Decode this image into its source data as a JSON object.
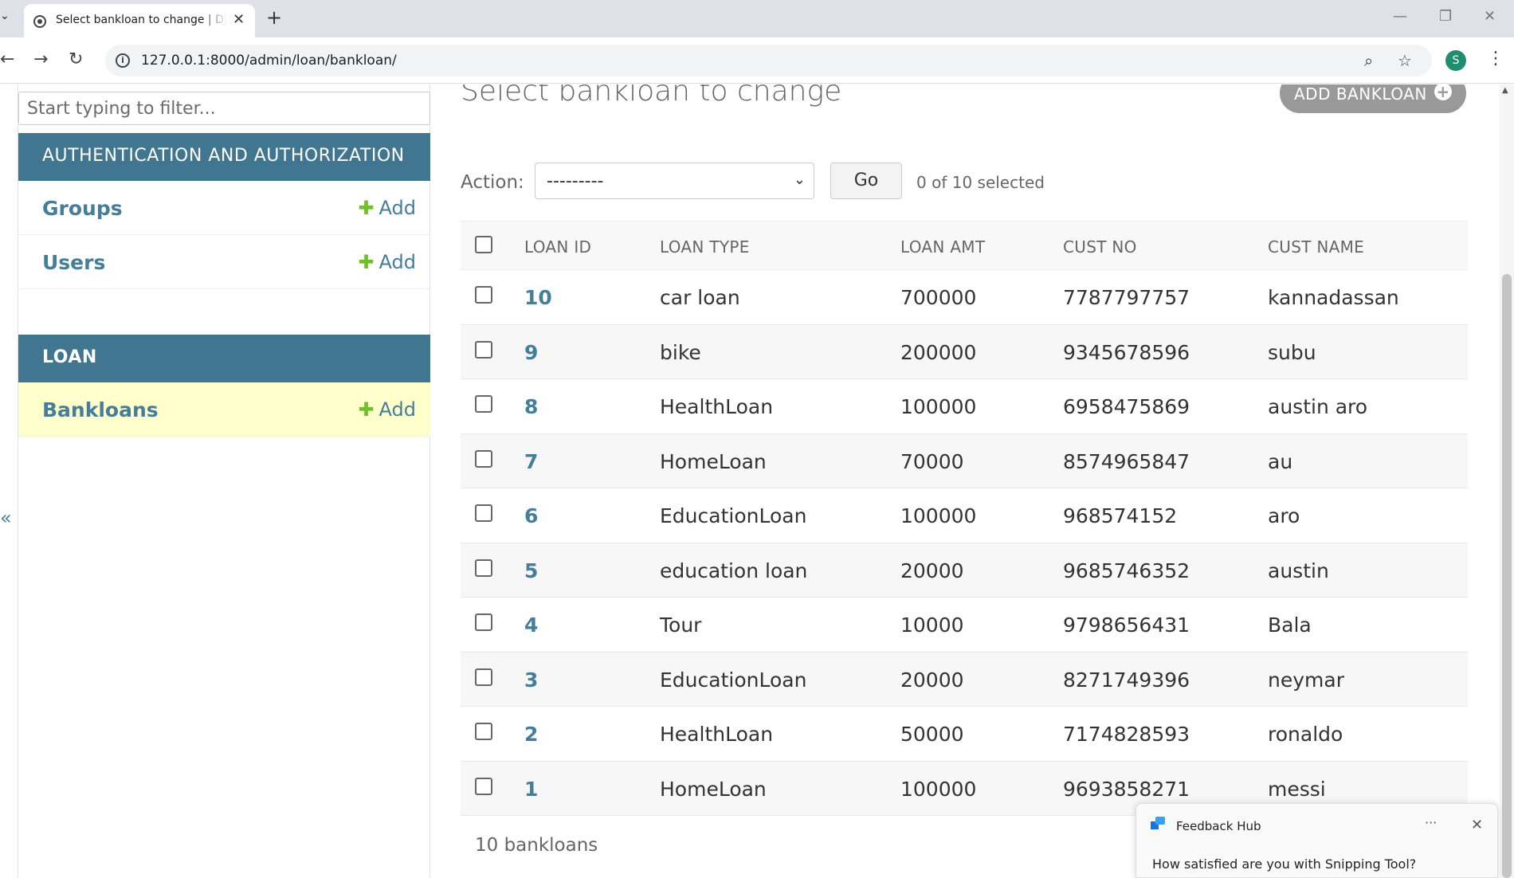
{
  "browser": {
    "tab_title": "Select bankloan to change | Django site admin",
    "url": "127.0.0.1:8000/admin/loan/bankloan/",
    "avatar_letter": "S"
  },
  "sidebar": {
    "filter_placeholder": "Start typing to filter...",
    "apps": [
      {
        "name": "AUTHENTICATION AND AUTHORIZATION",
        "models": [
          {
            "label": "Groups",
            "add": "Add"
          },
          {
            "label": "Users",
            "add": "Add"
          }
        ]
      },
      {
        "name": "LOAN",
        "models": [
          {
            "label": "Bankloans",
            "add": "Add"
          }
        ]
      }
    ],
    "collapse_glyph": "«"
  },
  "main": {
    "title": "Select bankloan to change",
    "add_button": "ADD BANKLOAN",
    "action_label": "Action:",
    "action_value": "---------",
    "go_label": "Go",
    "selected_text": "0 of 10 selected",
    "columns": [
      "LOAN ID",
      "LOAN TYPE",
      "LOAN AMT",
      "CUST NO",
      "CUST NAME"
    ],
    "rows": [
      [
        "10",
        "car loan",
        "700000",
        "7787797757",
        "kannadassan"
      ],
      [
        "9",
        "bike",
        "200000",
        "9345678596",
        "subu"
      ],
      [
        "8",
        "HealthLoan",
        "100000",
        "6958475869",
        "austin aro"
      ],
      [
        "7",
        "HomeLoan",
        "70000",
        "8574965847",
        "au"
      ],
      [
        "6",
        "EducationLoan",
        "100000",
        "968574152",
        "aro"
      ],
      [
        "5",
        "education loan",
        "20000",
        "9685746352",
        "austin"
      ],
      [
        "4",
        "Tour",
        "10000",
        "9798656431",
        "Bala"
      ],
      [
        "3",
        "EducationLoan",
        "20000",
        "8271749396",
        "neymar"
      ],
      [
        "2",
        "HealthLoan",
        "50000",
        "7174828593",
        "ronaldo"
      ],
      [
        "1",
        "HomeLoan",
        "100000",
        "9693858271",
        "messi"
      ]
    ],
    "paginator": "10 bankloans"
  },
  "toast": {
    "app": "Feedback Hub",
    "question": "How satisfied are you with Snipping Tool?",
    "more": "···",
    "close": "✕"
  },
  "colors": {
    "header_blue": "#417690",
    "link_blue": "#447e9b",
    "add_green": "#70bf2b",
    "active_row": "#ffffcc"
  }
}
